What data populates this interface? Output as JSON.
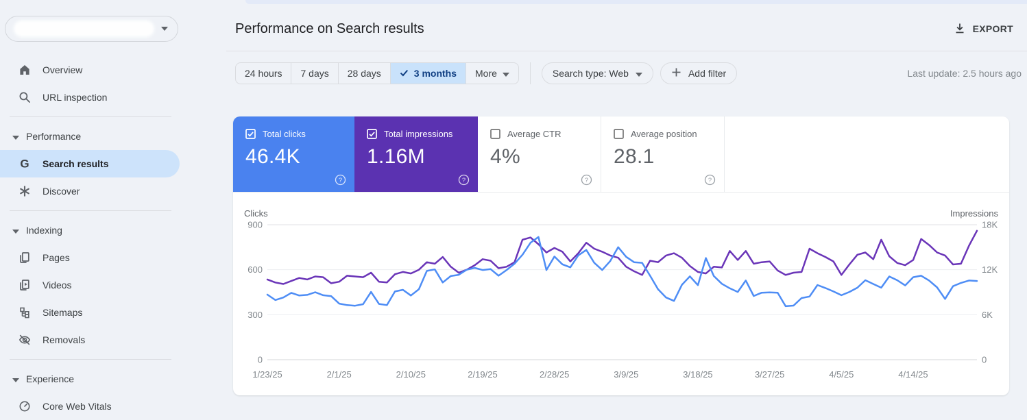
{
  "sidebar": {
    "property_selector": {
      "redacted": true
    },
    "items": [
      {
        "type": "item",
        "label": "Overview",
        "icon": "home"
      },
      {
        "type": "item",
        "label": "URL inspection",
        "icon": "search"
      },
      {
        "type": "divider"
      },
      {
        "type": "section",
        "label": "Performance"
      },
      {
        "type": "item",
        "label": "Search results",
        "icon": "g-logo",
        "selected": true
      },
      {
        "type": "item",
        "label": "Discover",
        "icon": "asterisk"
      },
      {
        "type": "divider"
      },
      {
        "type": "section",
        "label": "Indexing"
      },
      {
        "type": "item",
        "label": "Pages",
        "icon": "pages"
      },
      {
        "type": "item",
        "label": "Videos",
        "icon": "video"
      },
      {
        "type": "item",
        "label": "Sitemaps",
        "icon": "sitemap"
      },
      {
        "type": "item",
        "label": "Removals",
        "icon": "eye-off"
      },
      {
        "type": "divider"
      },
      {
        "type": "section",
        "label": "Experience"
      },
      {
        "type": "item",
        "label": "Core Web Vitals",
        "icon": "gauge"
      }
    ]
  },
  "header": {
    "title": "Performance on Search results",
    "export_label": "EXPORT"
  },
  "filters": {
    "date_ranges": [
      "24 hours",
      "7 days",
      "28 days",
      "3 months"
    ],
    "selected_range": "3 months",
    "more_label": "More",
    "search_type": "Search type: Web",
    "add_filter": "Add filter",
    "last_update": "Last update: 2.5 hours ago"
  },
  "metrics": {
    "cards": [
      {
        "label": "Total clicks",
        "value": "46.4K",
        "checked": true,
        "color": "#4a82ef",
        "text_color": "#ffffff"
      },
      {
        "label": "Total impressions",
        "value": "1.16M",
        "checked": true,
        "color": "#5b32b1",
        "text_color": "#ffffff"
      },
      {
        "label": "Average CTR",
        "value": "4%",
        "checked": false,
        "color": "#ffffff",
        "text_color": "#5f6368"
      },
      {
        "label": "Average position",
        "value": "28.1",
        "checked": false,
        "color": "#ffffff",
        "text_color": "#5f6368"
      }
    ]
  },
  "chart_data": {
    "type": "line",
    "title": "Performance on Search results",
    "x_tick_labels": [
      "1/23/25",
      "2/1/25",
      "2/10/25",
      "2/19/25",
      "2/28/25",
      "3/9/25",
      "3/18/25",
      "3/27/25",
      "4/5/25",
      "4/14/25"
    ],
    "x_tick_day_indices": [
      0,
      9,
      18,
      27,
      36,
      45,
      54,
      63,
      72,
      81
    ],
    "num_days": 90,
    "grid": true,
    "left_axis": {
      "label": "Clicks",
      "range": [
        0,
        900
      ],
      "ticks": [
        0,
        300,
        600,
        900
      ],
      "tick_labels": [
        "0",
        "300",
        "600",
        "900"
      ]
    },
    "right_axis": {
      "label": "Impressions",
      "range": [
        0,
        18000
      ],
      "ticks": [
        0,
        6000,
        12000,
        18000
      ],
      "tick_labels": [
        "0",
        "6K",
        "12K",
        "18K"
      ]
    },
    "series": [
      {
        "name": "Total clicks",
        "axis": "left",
        "color": "#4e8df5",
        "values": [
          434,
          398,
          415,
          446,
          428,
          432,
          450,
          430,
          424,
          374,
          364,
          360,
          370,
          452,
          372,
          364,
          455,
          466,
          428,
          470,
          592,
          602,
          515,
          558,
          566,
          600,
          612,
          598,
          604,
          560,
          598,
          640,
          700,
          780,
          818,
          598,
          688,
          636,
          616,
          696,
          732,
          646,
          598,
          658,
          750,
          686,
          650,
          646,
          560,
          470,
          415,
          392,
          500,
          556,
          497,
          678,
          558,
          506,
          476,
          452,
          528,
          425,
          447,
          449,
          447,
          357,
          361,
          411,
          421,
          498,
          478,
          455,
          430,
          452,
          480,
          530,
          505,
          480,
          555,
          530,
          495,
          550,
          560,
          528,
          482,
          405,
          490,
          512,
          528,
          525
        ]
      },
      {
        "name": "Total impressions",
        "axis": "right",
        "color": "#6a35b8",
        "values": [
          10700,
          10300,
          10100,
          10500,
          10900,
          10700,
          11100,
          11000,
          10200,
          10400,
          11200,
          11100,
          11000,
          11600,
          10400,
          10300,
          11400,
          11700,
          11500,
          12000,
          13000,
          12800,
          13700,
          12400,
          11600,
          12000,
          12600,
          13400,
          13200,
          12200,
          12400,
          13000,
          16000,
          16300,
          15400,
          14300,
          14900,
          14400,
          13100,
          14200,
          15600,
          14800,
          14400,
          13900,
          13600,
          12400,
          11800,
          11300,
          13200,
          13000,
          13900,
          14200,
          13600,
          12500,
          11700,
          11500,
          12400,
          12300,
          14500,
          13300,
          14500,
          12800,
          13000,
          13100,
          11900,
          11300,
          11600,
          11700,
          14800,
          14200,
          13700,
          13100,
          11300,
          12700,
          14000,
          14300,
          13400,
          16000,
          13800,
          12900,
          12600,
          13300,
          16100,
          15300,
          14300,
          13900,
          12700,
          12800,
          15200,
          17200
        ]
      }
    ]
  }
}
